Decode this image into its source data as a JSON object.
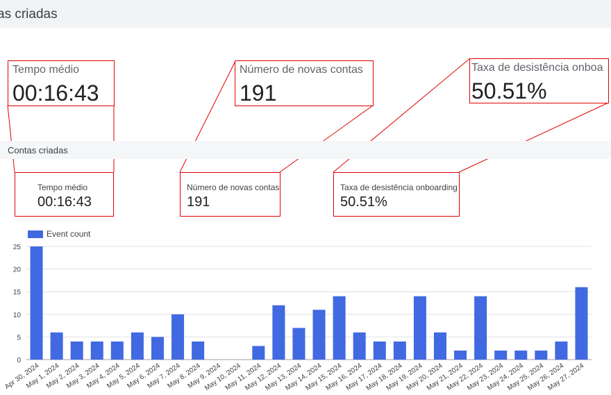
{
  "header": {
    "title": "as criadas"
  },
  "section": {
    "title": "Contas criadas"
  },
  "metrics": [
    {
      "label": "Tempo médio",
      "value": "00:16:43"
    },
    {
      "label": "Número de novas contas",
      "value": "191"
    },
    {
      "label": "Taxa de desistência onboarding",
      "value": "50.51%"
    }
  ],
  "zoom_labels": [
    "Tempo médio",
    "Número de novas contas",
    "Taxa de desistência onboa"
  ],
  "colors": {
    "bar": "#4169e1",
    "callout": "#e00000",
    "grid": "#e0e0e0"
  },
  "chart_data": {
    "type": "bar",
    "categories": [
      "Apr 30, 2024",
      "May 1, 2024",
      "May 2, 2024",
      "May 3, 2024",
      "May 4, 2024",
      "May 5, 2024",
      "May 6, 2024",
      "May 7, 2024",
      "May 8, 2024",
      "May 9, 2024",
      "May 10, 2024",
      "May 11, 2024",
      "May 12, 2024",
      "May 13, 2024",
      "May 14, 2024",
      "May 15, 2024",
      "May 16, 2024",
      "May 17, 2024",
      "May 18, 2024",
      "May 19, 2024",
      "May 20, 2024",
      "May 21, 2024",
      "May 22, 2024",
      "May 23, 2024",
      "May 24, 2024",
      "May 25, 2024",
      "May 26, 2024",
      "May 27, 2024"
    ],
    "series": [
      {
        "name": "Event count",
        "values": [
          25,
          6,
          4,
          4,
          4,
          6,
          5,
          10,
          4,
          0,
          0,
          3,
          12,
          7,
          11,
          14,
          6,
          4,
          4,
          14,
          6,
          2,
          14,
          2,
          2,
          2,
          4,
          16
        ]
      }
    ],
    "yticks": [
      0,
      5,
      10,
      15,
      20,
      25
    ],
    "ylim": [
      0,
      25
    ],
    "grid": true,
    "legend": "top-left"
  }
}
